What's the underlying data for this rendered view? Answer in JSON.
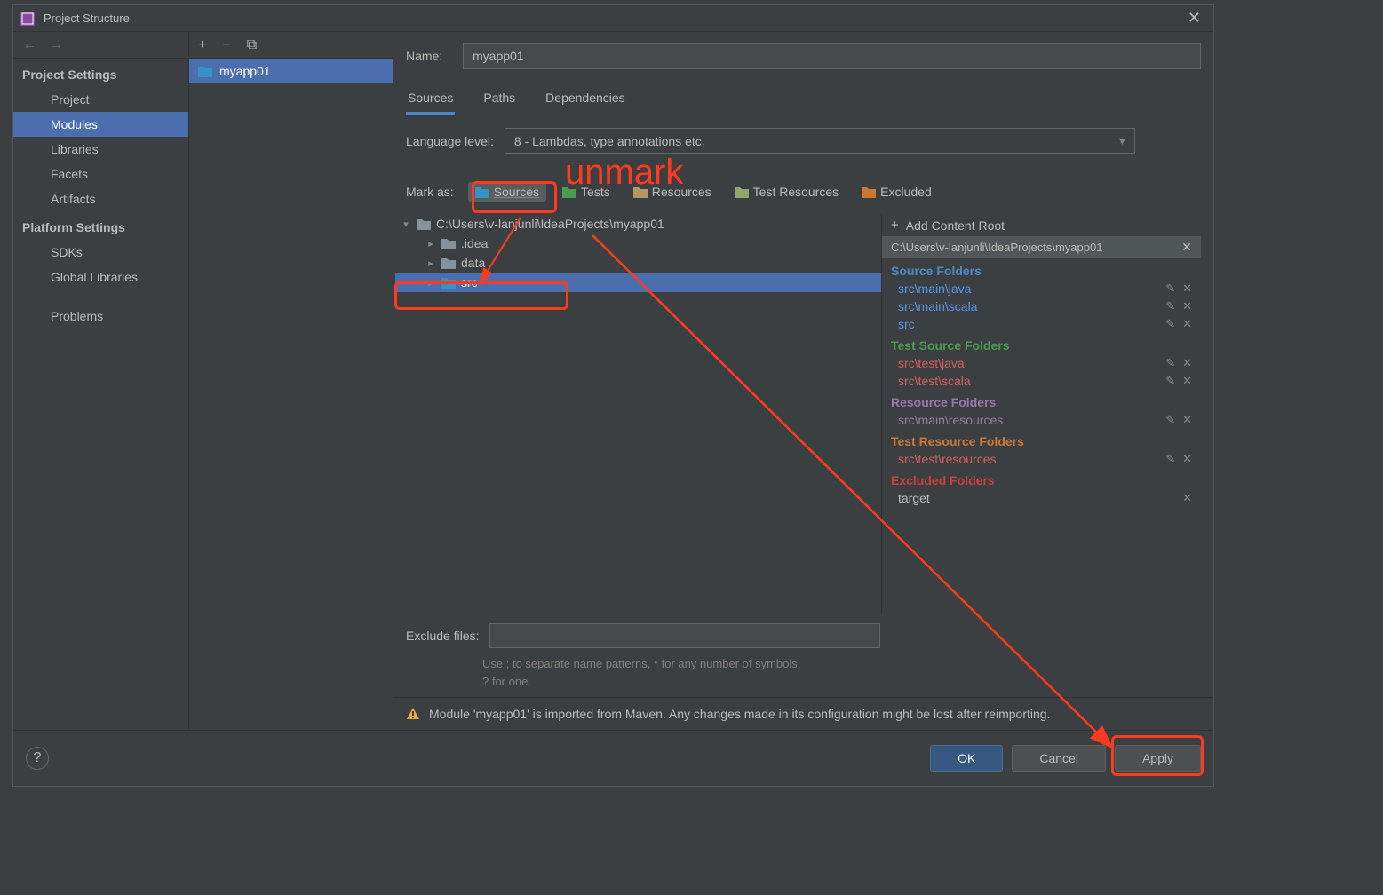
{
  "window": {
    "title": "Project Structure"
  },
  "sidebar": {
    "project_settings_label": "Project Settings",
    "items_top": [
      {
        "label": "Project"
      },
      {
        "label": "Modules",
        "selected": true
      },
      {
        "label": "Libraries"
      },
      {
        "label": "Facets"
      },
      {
        "label": "Artifacts"
      }
    ],
    "platform_settings_label": "Platform Settings",
    "items_platform": [
      {
        "label": "SDKs"
      },
      {
        "label": "Global Libraries"
      }
    ],
    "problems_label": "Problems"
  },
  "modules": {
    "selected": "myapp01"
  },
  "name": {
    "label": "Name:",
    "value": "myapp01"
  },
  "tabs": {
    "sources": "Sources",
    "paths": "Paths",
    "dependencies": "Dependencies"
  },
  "language": {
    "label": "Language level:",
    "value": "8 - Lambdas, type annotations etc."
  },
  "markas": {
    "label": "Mark as:",
    "sources": "Sources",
    "tests": "Tests",
    "resources": "Resources",
    "test_resources": "Test Resources",
    "excluded": "Excluded"
  },
  "tree": {
    "root": "C:\\Users\\v-lanjunli\\IdeaProjects\\myapp01",
    "children": [
      {
        "name": ".idea"
      },
      {
        "name": "data"
      },
      {
        "name": "src",
        "selected": true
      }
    ]
  },
  "roots": {
    "add_label": "Add Content Root",
    "content_root": "C:\\Users\\v-lanjunli\\IdeaProjects\\myapp01",
    "source_heading": "Source Folders",
    "source_folders": [
      "src\\main\\java",
      "src\\main\\scala",
      "src"
    ],
    "test_source_heading": "Test Source Folders",
    "test_source_folders": [
      "src\\test\\java",
      "src\\test\\scala"
    ],
    "resource_heading": "Resource Folders",
    "resource_folders": [
      "src\\main\\resources"
    ],
    "test_resource_heading": "Test Resource Folders",
    "test_resource_folders": [
      "src\\test\\resources"
    ],
    "excluded_heading": "Excluded Folders",
    "excluded_folders": [
      "target"
    ]
  },
  "exclude": {
    "label": "Exclude files:",
    "hint1": "Use ; to separate name patterns, * for any number of symbols,",
    "hint2": "? for one."
  },
  "warning": "Module 'myapp01' is imported from Maven. Any changes made in its configuration might be lost after reimporting.",
  "buttons": {
    "ok": "OK",
    "cancel": "Cancel",
    "apply": "Apply"
  },
  "annotation": {
    "unmark": "unmark"
  }
}
